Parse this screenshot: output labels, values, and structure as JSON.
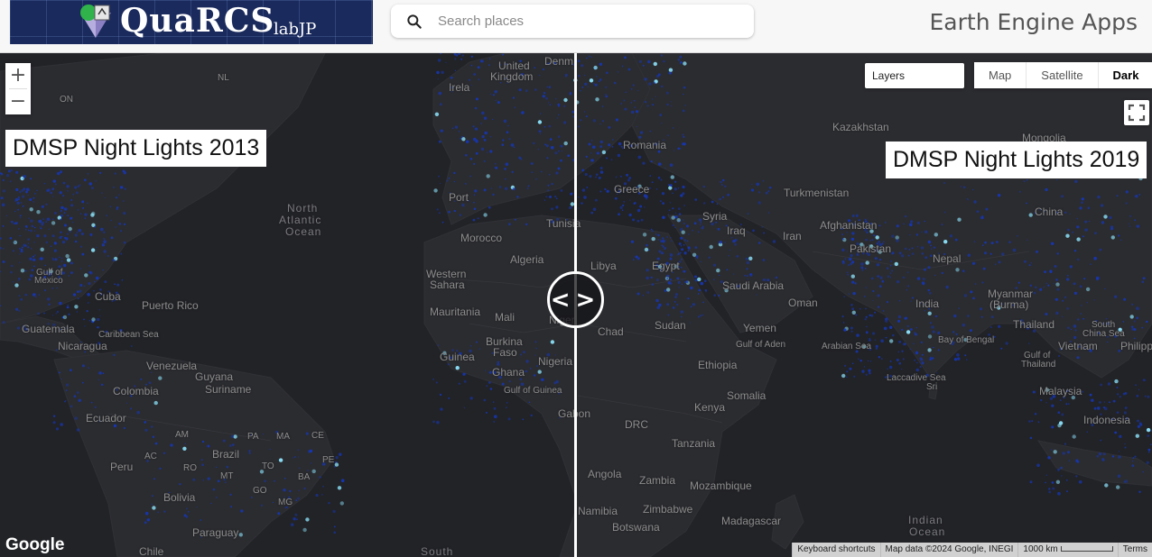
{
  "header": {
    "logo": {
      "name": "QuaRCS",
      "sub": "labJP"
    },
    "search": {
      "placeholder": "Search places"
    },
    "app_title": "Earth Engine Apps"
  },
  "map": {
    "left_layer_label": "DMSP Night Lights 2013",
    "right_layer_label": "DMSP Night Lights 2019",
    "zoom_in": "+",
    "zoom_out": "−",
    "layers_select": "Layers",
    "map_types": [
      "Map",
      "Satellite",
      "Dark"
    ],
    "active_map_type": "Dark",
    "swipe_handle": "<>",
    "google_logo": "Google",
    "attribution": {
      "shortcuts": "Keyboard shortcuts",
      "map_data": "Map data ©2024 Google, INEGI",
      "scale": "1000 km",
      "terms": "Terms"
    },
    "places": [
      {
        "text": "United"
      },
      {
        "text": "Kingdom"
      },
      {
        "text": "Denm"
      },
      {
        "text": "Irela"
      },
      {
        "text": "NL"
      },
      {
        "text": "ON"
      },
      {
        "text": "North"
      },
      {
        "text": "Atlantic"
      },
      {
        "text": "Ocean"
      },
      {
        "text": "Gulf of"
      },
      {
        "text": "Mexico"
      },
      {
        "text": "Cuba"
      },
      {
        "text": "Puerto Rico"
      },
      {
        "text": "Guatemala"
      },
      {
        "text": "Caribbean Sea"
      },
      {
        "text": "Nicaragua"
      },
      {
        "text": "Venezuela"
      },
      {
        "text": "Guyana"
      },
      {
        "text": "Suriname"
      },
      {
        "text": "Colombia"
      },
      {
        "text": "Ecuador"
      },
      {
        "text": "AM"
      },
      {
        "text": "PA"
      },
      {
        "text": "MA"
      },
      {
        "text": "CE"
      },
      {
        "text": "Brazil"
      },
      {
        "text": "AC"
      },
      {
        "text": "RO"
      },
      {
        "text": "TO"
      },
      {
        "text": "PE"
      },
      {
        "text": "Peru"
      },
      {
        "text": "MT"
      },
      {
        "text": "BA"
      },
      {
        "text": "Bolivia"
      },
      {
        "text": "GO"
      },
      {
        "text": "MG"
      },
      {
        "text": "Paraguay"
      },
      {
        "text": "Chile"
      },
      {
        "text": "South"
      },
      {
        "text": "Port"
      },
      {
        "text": "Tunisia"
      },
      {
        "text": "Morocco"
      },
      {
        "text": "Algeria"
      },
      {
        "text": "Western"
      },
      {
        "text": "Sahara"
      },
      {
        "text": "Mauritania"
      },
      {
        "text": "Mali"
      },
      {
        "text": "Niger"
      },
      {
        "text": "Burkina"
      },
      {
        "text": "Faso"
      },
      {
        "text": "Guinea"
      },
      {
        "text": "Nigeria"
      },
      {
        "text": "Ghana"
      },
      {
        "text": "Gulf of Guinea"
      },
      {
        "text": "Gabon"
      },
      {
        "text": "Libya"
      },
      {
        "text": "Egypt"
      },
      {
        "text": "Chad"
      },
      {
        "text": "Sudan"
      },
      {
        "text": "Ethiopia"
      },
      {
        "text": "Somalia"
      },
      {
        "text": "Kenya"
      },
      {
        "text": "DRC"
      },
      {
        "text": "Tanzania"
      },
      {
        "text": "Angola"
      },
      {
        "text": "Zambia"
      },
      {
        "text": "Mozambique"
      },
      {
        "text": "Namibia"
      },
      {
        "text": "Zimbabwe"
      },
      {
        "text": "Botswana"
      },
      {
        "text": "Madagascar"
      },
      {
        "text": "Romania"
      },
      {
        "text": "Greece"
      },
      {
        "text": "Syria"
      },
      {
        "text": "Iraq"
      },
      {
        "text": "Iran"
      },
      {
        "text": "Saudi Arabia"
      },
      {
        "text": "Yemen"
      },
      {
        "text": "Gulf of Aden"
      },
      {
        "text": "Oman"
      },
      {
        "text": "Arabian Sea"
      },
      {
        "text": "Kazakhstan"
      },
      {
        "text": "Turkmenistan"
      },
      {
        "text": "Afghanistan"
      },
      {
        "text": "Pakistan"
      },
      {
        "text": "Nepal"
      },
      {
        "text": "India"
      },
      {
        "text": "Mongolia"
      },
      {
        "text": "China"
      },
      {
        "text": "Myanmar"
      },
      {
        "text": "(Burma)"
      },
      {
        "text": "Thailand"
      },
      {
        "text": "Bay of Bengal"
      },
      {
        "text": "South"
      },
      {
        "text": "China Sea"
      },
      {
        "text": "Vietnam"
      },
      {
        "text": "Philipp"
      },
      {
        "text": "Gulf of"
      },
      {
        "text": "Thailand"
      },
      {
        "text": "Laccadive Sea"
      },
      {
        "text": "Malaysia"
      },
      {
        "text": "Indonesia"
      },
      {
        "text": "Indian"
      },
      {
        "text": "Ocean"
      },
      {
        "text": "Sri"
      }
    ]
  },
  "colors": {
    "map_background": "#222327",
    "land": "#2b2c30",
    "lights_dim": "#1536b8",
    "lights_bright": "#8ee6ff",
    "logo_bg": "#1a2a5c"
  }
}
